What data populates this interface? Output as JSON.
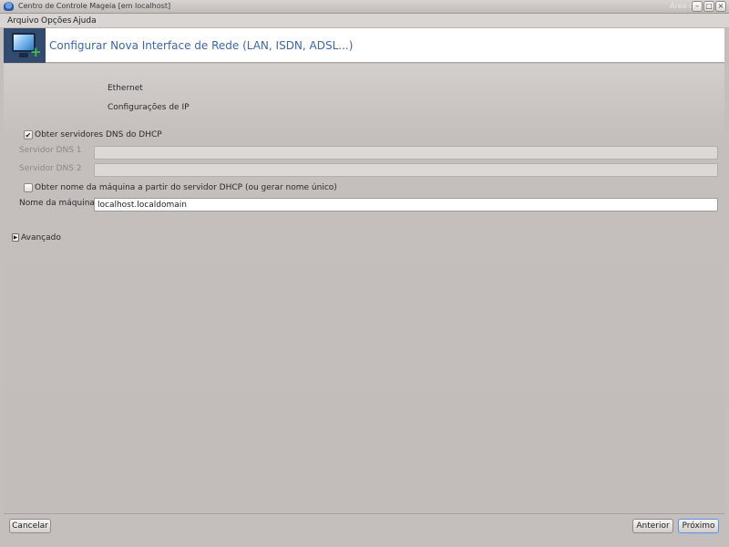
{
  "window": {
    "title": "Centro de Controle Mageia  [em localhost]",
    "title_right": "Área d",
    "minimize_glyph": "–",
    "maximize_glyph": "□",
    "close_glyph": "×"
  },
  "menu": {
    "items": [
      "Arquivo",
      "Opções",
      "Ajuda"
    ]
  },
  "header": {
    "title": "Configurar Nova Interface de Rede (LAN, ISDN, ADSL...)",
    "icon": "network-monitor-add-icon",
    "plus_glyph": "+"
  },
  "form": {
    "interface_type": "Ethernet",
    "section_title": "Configurações de IP",
    "dns_from_dhcp": {
      "label": "Obter servidores DNS do DHCP",
      "checked": true,
      "mark": "✔"
    },
    "dns1": {
      "label": "Servidor DNS 1",
      "value": ""
    },
    "dns2": {
      "label": "Servidor DNS 2",
      "value": ""
    },
    "hostname_from_dhcp": {
      "label": "Obter nome da máquina a partir do servidor DHCP (ou gerar nome único)",
      "checked": false,
      "mark": ""
    },
    "hostname": {
      "label": "Nome da máquina",
      "value": "localhost.localdomain"
    },
    "advanced": {
      "label": "Avançado",
      "glyph": "▶"
    }
  },
  "buttons": {
    "cancel": "Cancelar",
    "previous": "Anterior",
    "next": "Próximo"
  },
  "colors": {
    "header_title": "#3a66b4",
    "header_icon_bg": "#334b6e",
    "background": "#c4bebc"
  }
}
